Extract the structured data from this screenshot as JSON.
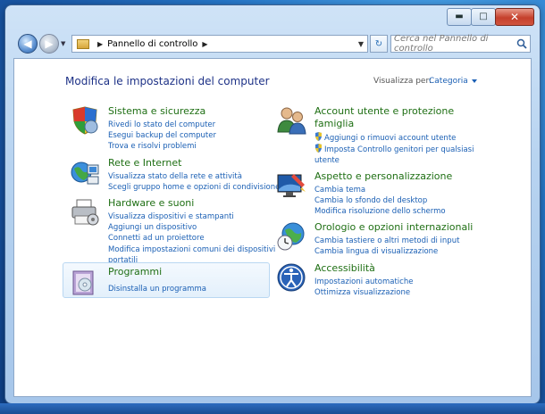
{
  "window": {
    "title": ""
  },
  "address": {
    "crumb": "Pannello di controllo"
  },
  "search": {
    "placeholder": "Cerca nel Pannello di controllo"
  },
  "header": {
    "title": "Modifica le impostazioni del computer",
    "view_by_label": "Visualizza per:",
    "view_by_value": "Categoria"
  },
  "categories": {
    "sistema": {
      "title": "Sistema e sicurezza",
      "links": [
        "Rivedi lo stato del computer",
        "Esegui backup del computer",
        "Trova e risolvi problemi"
      ]
    },
    "rete": {
      "title": "Rete e Internet",
      "links": [
        "Visualizza stato della rete e attività",
        "Scegli gruppo home e opzioni di condivisione"
      ]
    },
    "hardware": {
      "title": "Hardware e suoni",
      "links": [
        "Visualizza dispositivi e stampanti",
        "Aggiungi un dispositivo",
        "Connetti ad un proiettore",
        "Modifica impostazioni comuni dei dispositivi",
        "portatili"
      ]
    },
    "programmi": {
      "title": "Programmi",
      "links": [
        "Disinstalla un programma"
      ]
    },
    "account": {
      "title_line1": "Account utente e protezione",
      "title_line2": "famiglia",
      "links": [
        "Aggiungi o rimuovi account utente",
        "Imposta Controllo genitori per qualsiasi",
        "utente"
      ]
    },
    "aspetto": {
      "title": "Aspetto e personalizzazione",
      "links": [
        "Cambia tema",
        "Cambia lo sfondo del desktop",
        "Modifica risoluzione dello schermo"
      ]
    },
    "orologio": {
      "title": "Orologio e opzioni internazionali",
      "links": [
        "Cambia tastiere o altri metodi di input",
        "Cambia lingua di visualizzazione"
      ]
    },
    "accessibilita": {
      "title": "Accessibilità",
      "links": [
        "Impostazioni automatiche",
        "Ottimizza visualizzazione"
      ]
    }
  },
  "colors": {
    "link": "#1a5fb4",
    "category_title": "#1f6f14",
    "page_title": "#1e3287"
  }
}
